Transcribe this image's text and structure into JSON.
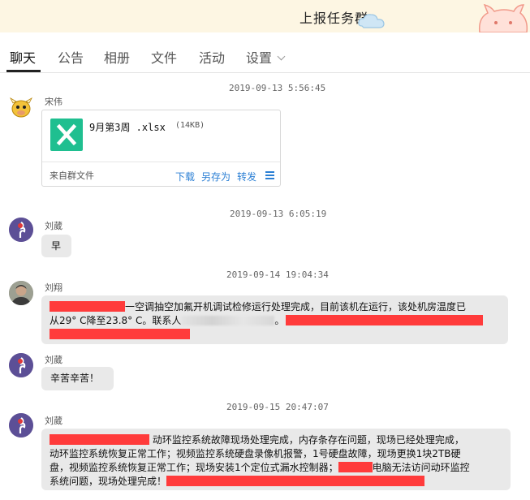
{
  "window": {
    "title": "上报任务群"
  },
  "tabs": [
    {
      "label": "聊天"
    },
    {
      "label": "公告"
    },
    {
      "label": "相册"
    },
    {
      "label": "文件"
    },
    {
      "label": "活动"
    },
    {
      "label": "设置"
    }
  ],
  "colors": {
    "accent": "#2b7fd4",
    "excel": "#1fbf90",
    "redaction": "#ff3b3b",
    "bubble": "#e9e9e9"
  },
  "messages": [
    {
      "timestamp": "2019-09-13 5:56:45",
      "sender": "宋伟",
      "file": {
        "name": "9月第3周 .xlsx",
        "size": "(14KB)",
        "source": "来自群文件",
        "actions": {
          "download": "下载",
          "save_as": "另存为",
          "forward": "转发"
        }
      }
    },
    {
      "timestamp": "2019-09-13 6:05:19",
      "sender": "刘葳",
      "text": "早"
    },
    {
      "timestamp": "2019-09-14 19:04:34",
      "sender": "刘翔",
      "line1": "一空调抽空加氟开机调试检修运行处理完成，目前该机在运行，该处机房温度已",
      "line2a": "从29° C降至23.8° C。联系人",
      "line2b": "。"
    },
    {
      "sender": "刘葳",
      "text": "辛苦辛苦！"
    },
    {
      "timestamp": "2019-09-15 20:47:07",
      "sender": "刘葳",
      "line1": " 动环监控系统故障现场处理完成，内存条存在问题，现场已经处理完成，",
      "line2": "动环监控系统恢复正常工作；视频监控系统硬盘录像机报警，1号硬盘故障，现场更换1块2TB硬",
      "line3": "盘，视频监控系统恢复正常工作；现场安装1个定位式漏水控制器；",
      "line3b": "电脑无法访问动环监控",
      "line4": "系统问题，现场处理完成！"
    }
  ]
}
